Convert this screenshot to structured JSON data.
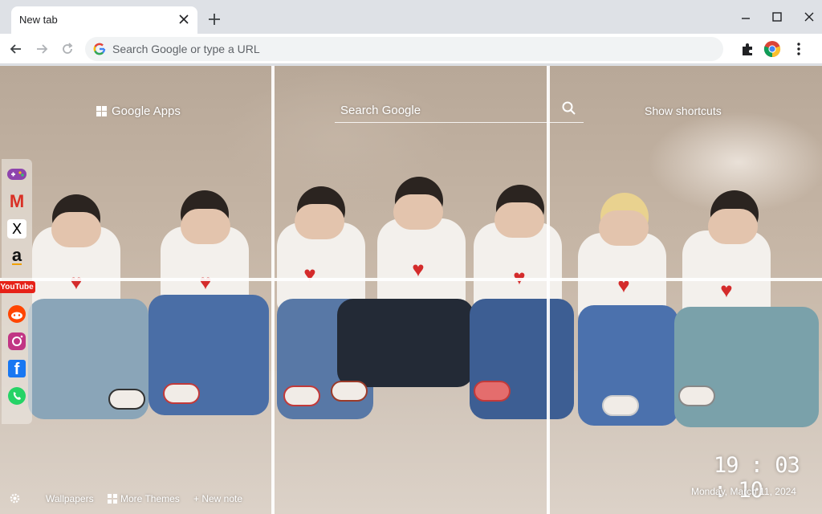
{
  "browser": {
    "tab": {
      "title": "New tab"
    },
    "omnibox": {
      "placeholder": "Search Google or type a URL"
    },
    "icons": [
      "close-icon",
      "plus-icon",
      "minimize-icon",
      "maximize-icon",
      "window-close-icon",
      "back-icon",
      "forward-icon",
      "reload-icon",
      "google-g-icon",
      "extensions-icon",
      "chrome-profile-icon",
      "kebab-menu-icon"
    ]
  },
  "ntp": {
    "google_apps_label": "Google Apps",
    "search_placeholder": "Search Google",
    "show_shortcuts_label": "Show shortcuts",
    "sidebar": [
      {
        "name": "games",
        "icon": "gamepad-icon"
      },
      {
        "name": "gmail",
        "icon": "gmail-icon",
        "glyph": "M"
      },
      {
        "name": "x",
        "icon": "x-icon",
        "glyph": "X"
      },
      {
        "name": "amazon",
        "icon": "amazon-icon",
        "glyph": "a"
      },
      {
        "name": "youtube",
        "icon": "youtube-icon",
        "glyph": "YouTube"
      },
      {
        "name": "reddit",
        "icon": "reddit-icon"
      },
      {
        "name": "instagram",
        "icon": "instagram-icon"
      },
      {
        "name": "facebook",
        "icon": "facebook-icon",
        "glyph": "f"
      },
      {
        "name": "whatsapp",
        "icon": "whatsapp-icon"
      }
    ],
    "clock": {
      "time": "19 : 03 : 10",
      "date": "Monday, March 11, 2024"
    },
    "bottom_bar": {
      "wallpapers_label": "Wallpapers",
      "more_themes_label": "More Themes",
      "new_note_label": "+ New note"
    }
  },
  "colors": {
    "tab_strip": "#dee1e6",
    "omnibox_bg": "#f1f3f4",
    "heart": "#d42b2b"
  }
}
